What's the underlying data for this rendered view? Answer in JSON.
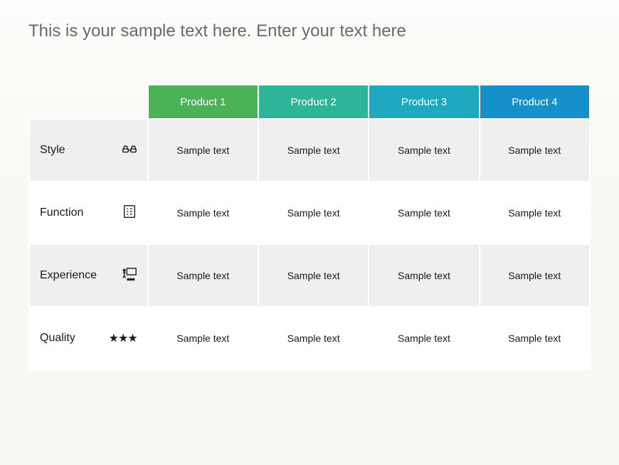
{
  "title": "This is your sample text here. Enter your text here",
  "columns": [
    "Product 1",
    "Product 2",
    "Product 3",
    "Product 4"
  ],
  "rows": [
    {
      "label": "Style",
      "icon": "glasses-icon",
      "cells": [
        "Sample text",
        "Sample text",
        "Sample text",
        "Sample text"
      ]
    },
    {
      "label": "Function",
      "icon": "checklist-icon",
      "cells": [
        "Sample text",
        "Sample text",
        "Sample text",
        "Sample text"
      ]
    },
    {
      "label": "Experience",
      "icon": "presentation-icon",
      "cells": [
        "Sample text",
        "Sample text",
        "Sample text",
        "Sample text"
      ]
    },
    {
      "label": "Quality",
      "icon": "stars-icon",
      "cells": [
        "Sample text",
        "Sample text",
        "Sample text",
        "Sample text"
      ]
    }
  ]
}
